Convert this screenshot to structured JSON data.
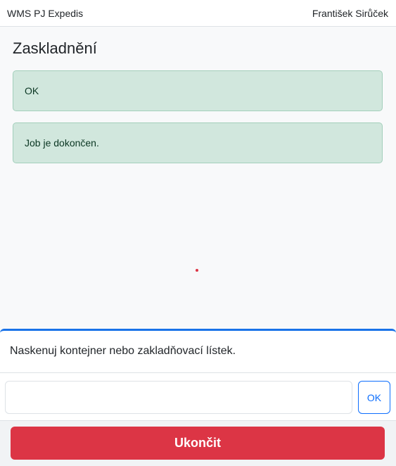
{
  "header": {
    "app_title": "WMS PJ Expedis",
    "user_name": "František Sirůček"
  },
  "page": {
    "title": "Zaskladnění"
  },
  "alerts": [
    {
      "text": "OK"
    },
    {
      "text": "Job je dokončen."
    }
  ],
  "scan": {
    "prompt": "Naskenuj kontejner nebo zakladňovací lístek.",
    "input_value": "",
    "ok_label": "OK"
  },
  "footer": {
    "finish_label": "Ukončit"
  },
  "colors": {
    "success_bg": "#d1e7dd",
    "success_text": "#0a3622",
    "accent": "#0d6efd",
    "danger": "#dc3545"
  }
}
